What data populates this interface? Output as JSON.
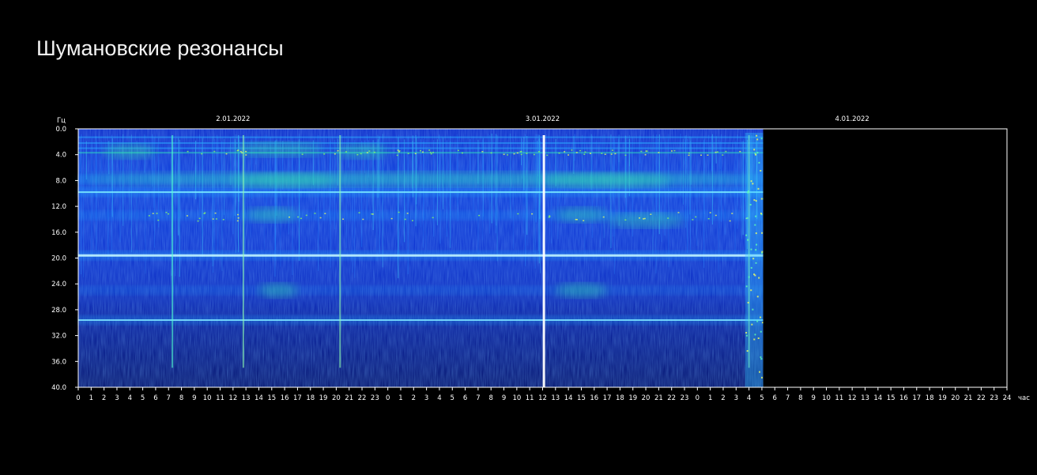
{
  "page": {
    "title": "Шумановские резонансы"
  },
  "chart_data": {
    "type": "heatmap",
    "title": "",
    "ylabel": "Гц",
    "xlabel": "час",
    "ylim": [
      0,
      40
    ],
    "y_ticks": [
      "0.0",
      "4.0",
      "8.0",
      "12.0",
      "16.0",
      "20.0",
      "24.0",
      "28.0",
      "32.0",
      "36.0",
      "40.0"
    ],
    "dates": [
      "2.01.2022",
      "3.01.2022",
      "4.01.2022"
    ],
    "x_ticks": [
      "0",
      "1",
      "2",
      "3",
      "4",
      "5",
      "6",
      "7",
      "8",
      "9",
      "10",
      "11",
      "12",
      "13",
      "14",
      "15",
      "16",
      "17",
      "18",
      "19",
      "20",
      "21",
      "22",
      "23",
      "0",
      "1",
      "2",
      "3",
      "4",
      "5",
      "6",
      "7",
      "8",
      "9",
      "10",
      "11",
      "12",
      "13",
      "14",
      "15",
      "16",
      "17",
      "18",
      "19",
      "20",
      "21",
      "22",
      "23",
      "0",
      "1",
      "2",
      "3",
      "4",
      "5",
      "6",
      "7",
      "8",
      "9",
      "10",
      "11",
      "12",
      "13",
      "14",
      "15",
      "16",
      "17",
      "18",
      "19",
      "20",
      "21",
      "22",
      "23",
      "24"
    ],
    "x_range_hours": [
      0,
      72
    ],
    "data_end_hour": 53.1,
    "grid": false,
    "colormap": [
      "#00004a",
      "#0014c8",
      "#0050ff",
      "#00b4ff",
      "#30ffb0",
      "#e0ff40",
      "#ffffff"
    ],
    "frequency_bands_hz": [
      {
        "center": 7.8,
        "intensity": 0.45
      },
      {
        "center": 9.8,
        "intensity": 0.6
      },
      {
        "center": 13.4,
        "intensity": 0.42
      },
      {
        "center": 19.6,
        "intensity": 0.65
      },
      {
        "center": 25.0,
        "intensity": 0.3
      },
      {
        "center": 29.6,
        "intensity": 0.5
      }
    ],
    "bright_events_hour": [
      7.3,
      12.8,
      20.3,
      36.1,
      52.0
    ],
    "colors": {
      "background": "#000000",
      "frame": "#ffffff",
      "text": "#ffffff"
    }
  }
}
